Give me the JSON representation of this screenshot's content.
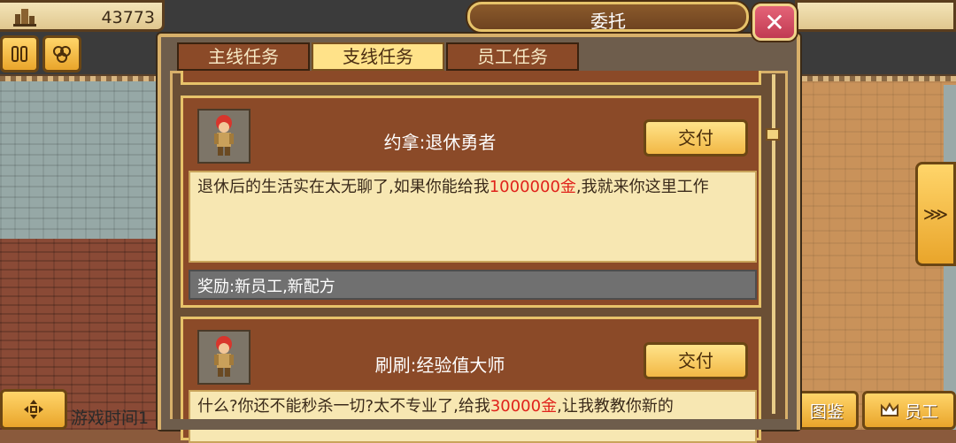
{
  "hud": {
    "gold_value": "43773",
    "gold_icon": "buildings-icon",
    "pause_icon": "pause-icon",
    "map_icon": "pan-icon",
    "move_icon": "dpad-icon",
    "game_time_label": "游戏时间1"
  },
  "dialog": {
    "title": "委托",
    "close_symbol": "✕",
    "tabs": [
      {
        "label": "主线任务",
        "active": false
      },
      {
        "label": "支线任务",
        "active": true
      },
      {
        "label": "员工任务",
        "active": false
      }
    ]
  },
  "quests": [
    {
      "npc_name": "约拿:退休勇者",
      "deliver_label": "交付",
      "desc_before": "退休后的生活实在太无聊了,如果你能给我",
      "desc_highlight": "1000000金",
      "desc_after": ",我就来你这里工作",
      "reward": "奖励:新员工,新配方"
    },
    {
      "npc_name": "刷刷:经验值大师",
      "deliver_label": "交付",
      "desc_before": "什么?你还不能秒杀一切?太不专业了,给我",
      "desc_highlight": "30000金",
      "desc_after": ",让我教教你新的"
    }
  ],
  "bottom_buttons": {
    "encyclopedia": "图鉴",
    "staff": "员工",
    "staff_icon": "crown-icon"
  },
  "side_arrow_symbol": "⋙",
  "colors": {
    "highlight_red": "#e0221b",
    "button_gold": "#f2b845",
    "card_brown": "#8b4a28",
    "desc_cream": "#f7e7b2",
    "close_red": "#c13a52"
  }
}
